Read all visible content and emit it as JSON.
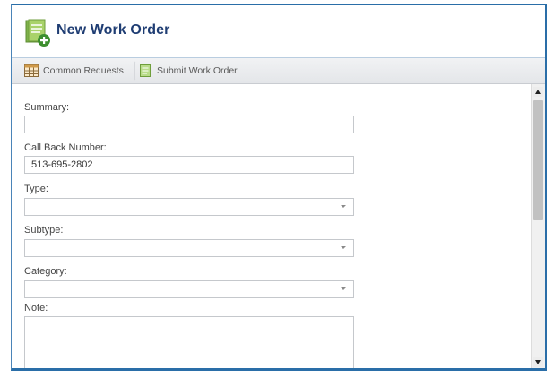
{
  "window": {
    "title": "New Work Order",
    "accent_color": "#2a6ea8",
    "title_color": "#1f3d73",
    "icon": "new-document-icon"
  },
  "toolbar": {
    "common_requests_label": "Common Requests",
    "common_requests_icon": "calendar-table-icon",
    "submit_label": "Submit Work Order",
    "submit_icon": "green-document-icon"
  },
  "form": {
    "summary": {
      "label": "Summary:",
      "value": ""
    },
    "call_back_number": {
      "label": "Call Back Number:",
      "value": "513-695-2802"
    },
    "type": {
      "label": "Type:",
      "selected": ""
    },
    "subtype": {
      "label": "Subtype:",
      "selected": ""
    },
    "category": {
      "label": "Category:",
      "selected": ""
    },
    "note": {
      "label": "Note:",
      "value": ""
    }
  },
  "scrollbar": {
    "visible": true,
    "position": 0
  }
}
